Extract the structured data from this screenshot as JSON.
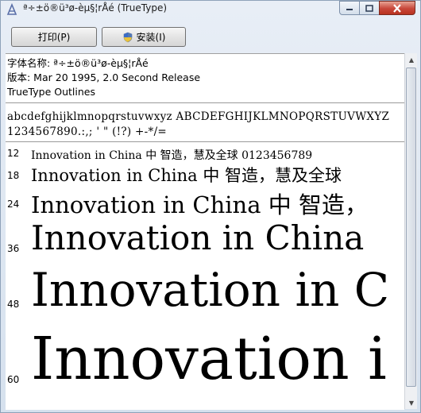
{
  "window": {
    "title": "ª÷±ö®ü³ø-èµ§¦rÅé (TrueType)",
    "app_icon": "font-file-icon",
    "controls": [
      "minimize-icon",
      "maximize-icon",
      "close-icon"
    ]
  },
  "toolbar": {
    "print_label": "打印(P)",
    "install_label": "安装(I)",
    "install_icon": "uac-shield-icon"
  },
  "font_info": {
    "name_line": "字体名称: ª÷±ö®ü³ø-èµ§¦rÅé",
    "version_line": "版本: Mar 20 1995, 2.0 Second Release",
    "type_line": "TrueType Outlines"
  },
  "charset": {
    "line1": "abcdefghijklmnopqrstuvwxyz ABCDEFGHIJKLMNOPQRSTUVWXYZ",
    "line2": "1234567890.:,; ' \" (!?) +-*/="
  },
  "samples": [
    {
      "size": "12",
      "text": "Innovation in China 中   智造，慧及全球 0123456789"
    },
    {
      "size": "18",
      "text": "Innovation in China 中   智造，慧及全球"
    },
    {
      "size": "24",
      "text": "Innovation in China 中   智造，"
    },
    {
      "size": "36",
      "text": "Innovation in China"
    },
    {
      "size": "48",
      "text": "Innovation in C"
    },
    {
      "size": "60",
      "text": "Innovation i"
    }
  ]
}
